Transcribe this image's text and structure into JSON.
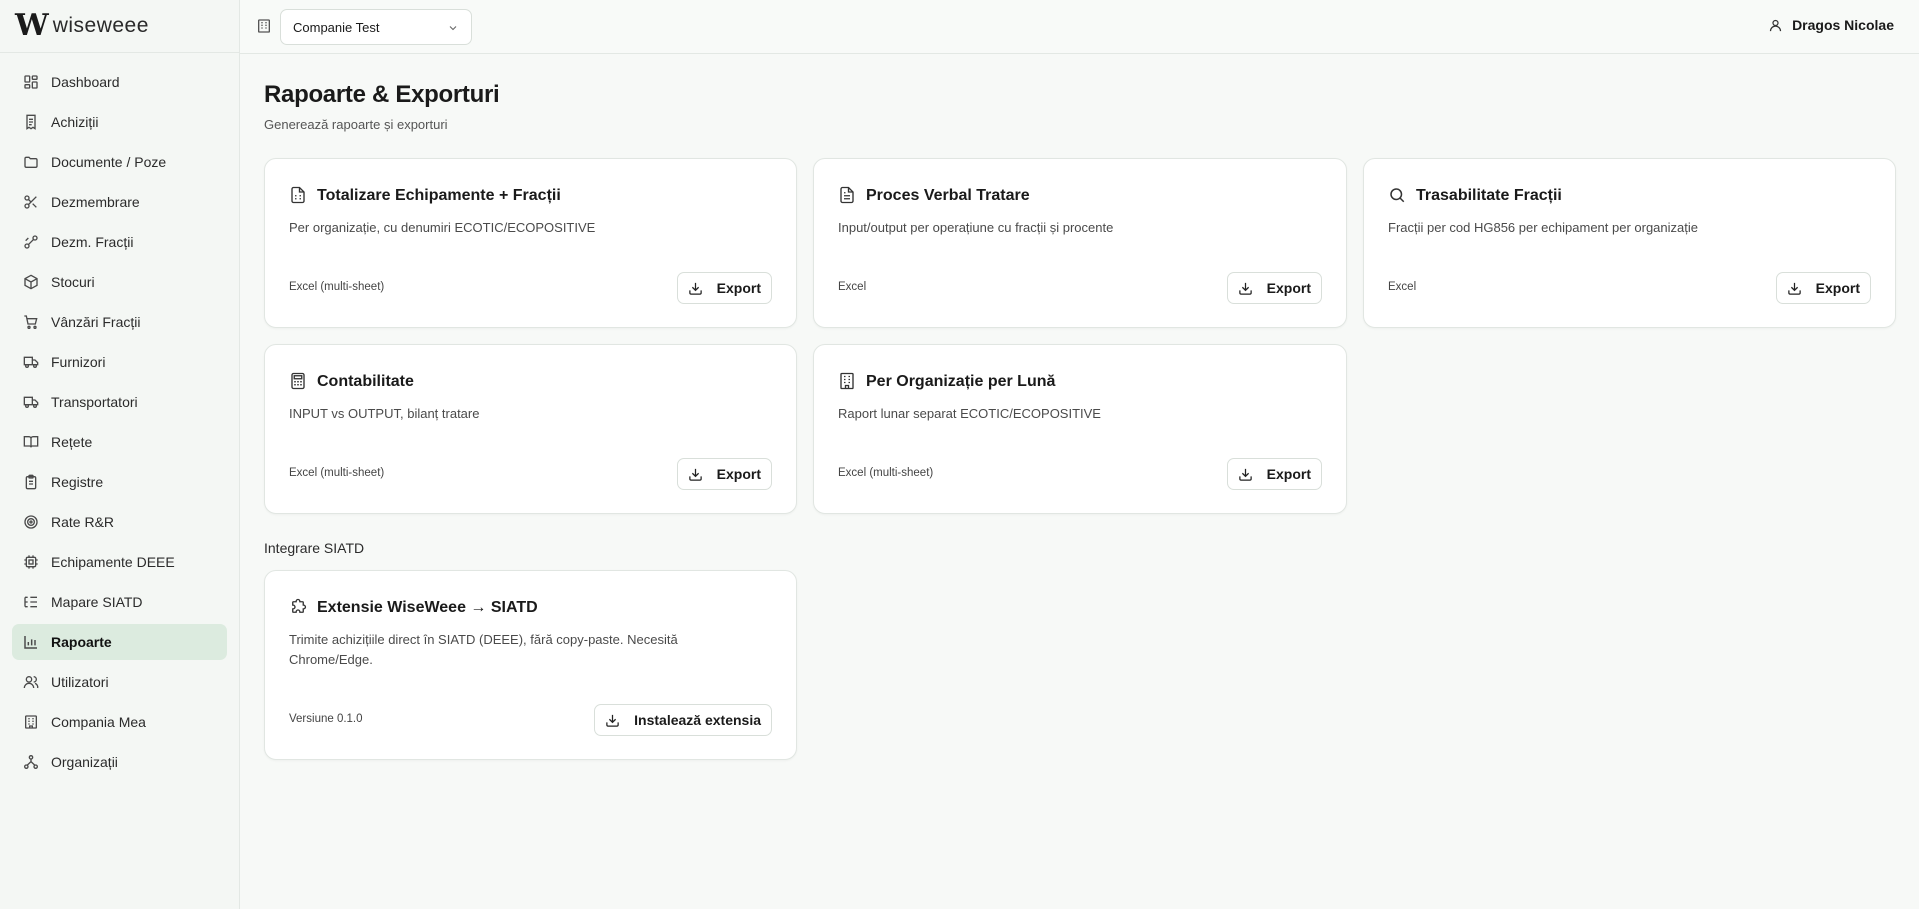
{
  "app": {
    "logo_mark": "W",
    "logo_text": "wiseweee"
  },
  "sidebar": {
    "items": [
      {
        "label": "Dashboard",
        "icon": "grid-icon"
      },
      {
        "label": "Achiziții",
        "icon": "receipt-icon"
      },
      {
        "label": "Documente / Poze",
        "icon": "folder-icon"
      },
      {
        "label": "Dezmembrare",
        "icon": "scissors-icon"
      },
      {
        "label": "Dezm. Fracții",
        "icon": "git-branch-icon"
      },
      {
        "label": "Stocuri",
        "icon": "package-icon"
      },
      {
        "label": "Vânzări Fracții",
        "icon": "cart-icon"
      },
      {
        "label": "Furnizori",
        "icon": "truck-icon"
      },
      {
        "label": "Transportatori",
        "icon": "truck-icon"
      },
      {
        "label": "Rețete",
        "icon": "book-icon"
      },
      {
        "label": "Registre",
        "icon": "clipboard-icon"
      },
      {
        "label": "Rate R&R",
        "icon": "target-icon"
      },
      {
        "label": "Echipamente DEEE",
        "icon": "cpu-icon"
      },
      {
        "label": "Mapare SIATD",
        "icon": "list-tree-icon"
      },
      {
        "label": "Rapoarte",
        "icon": "bar-chart-icon",
        "active": true
      },
      {
        "label": "Utilizatori",
        "icon": "users-icon"
      },
      {
        "label": "Compania Mea",
        "icon": "building-icon"
      },
      {
        "label": "Organizații",
        "icon": "network-icon"
      }
    ]
  },
  "header": {
    "company_select": "Companie Test",
    "user_name": "Dragos Nicolae"
  },
  "main": {
    "title": "Rapoarte & Exporturi",
    "subtitle": "Generează rapoarte și exporturi",
    "reports": [
      {
        "title": "Totalizare Echipamente + Fracții",
        "desc": "Per organizație, cu denumiri ECOTIC/ECOPOSITIVE",
        "format": "Excel (multi-sheet)",
        "button": "Export",
        "icon": "file-spreadsheet-icon"
      },
      {
        "title": "Proces Verbal Tratare",
        "desc": "Input/output per operațiune cu fracții și procente",
        "format": "Excel",
        "button": "Export",
        "icon": "file-text-icon"
      },
      {
        "title": "Trasabilitate Fracții",
        "desc": "Fracții per cod HG856 per echipament per organizație",
        "format": "Excel",
        "button": "Export",
        "icon": "search-icon"
      },
      {
        "title": "Contabilitate",
        "desc": "INPUT vs OUTPUT, bilanț tratare",
        "format": "Excel (multi-sheet)",
        "button": "Export",
        "icon": "calculator-icon"
      },
      {
        "title": "Per Organizație per Lună",
        "desc": "Raport lunar separat ECOTIC/ECOPOSITIVE",
        "format": "Excel (multi-sheet)",
        "button": "Export",
        "icon": "building-icon"
      }
    ],
    "integration_label": "Integrare SIATD",
    "integration": {
      "title": "Extensie WiseWeee → SIATD",
      "desc": "Trimite achizițiile direct în SIATD (DEEE), fără copy-paste. Necesită Chrome/Edge.",
      "version": "Versiune 0.1.0",
      "button": "Instalează extensia",
      "icon": "puzzle-icon"
    }
  }
}
